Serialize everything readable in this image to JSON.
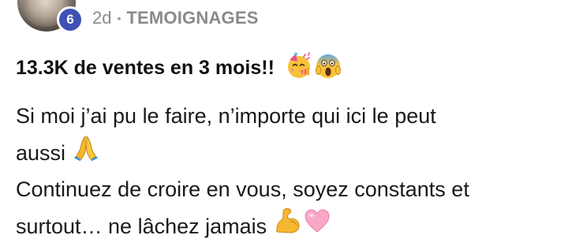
{
  "header": {
    "level_badge": "6",
    "time_ago": "2d",
    "separator": "•",
    "category": "TEMOIGNAGES"
  },
  "post": {
    "title": "13.3K de ventes en 3 mois!!",
    "title_emojis": [
      "party-face-emoji",
      "screaming-face-emoji"
    ],
    "body_lines": [
      "Si moi j’ai pu le faire, n’importe qui ici le peut",
      "aussi",
      "Continuez de croire en vous, soyez constants et",
      "surtout… ne lâchez jamais"
    ],
    "body_emojis": {
      "line2": "folded-hands-emoji",
      "line4": [
        "flexed-biceps-emoji",
        "pink-heart-emoji"
      ]
    }
  }
}
